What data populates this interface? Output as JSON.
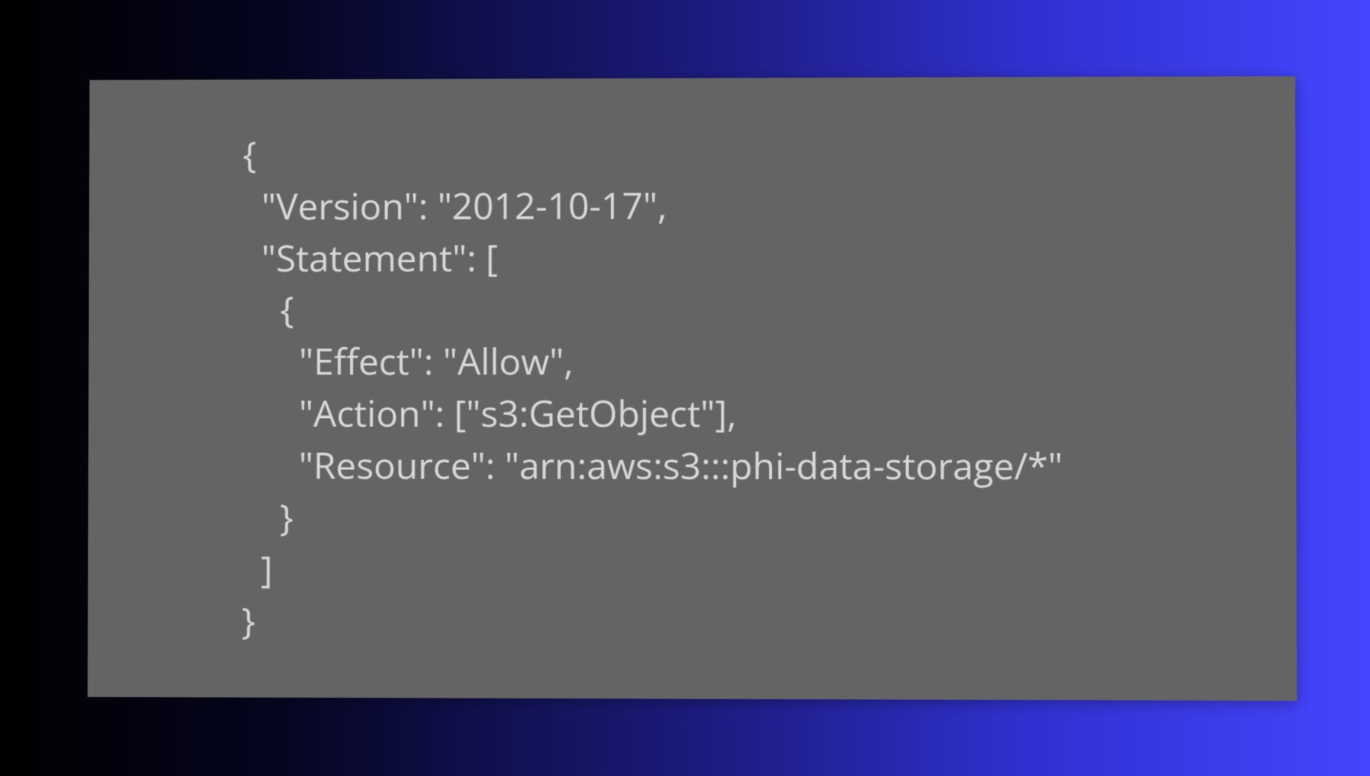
{
  "code_block": {
    "lines": [
      "{",
      "  \"Version\": \"2012-10-17\",",
      "  \"Statement\": [",
      "    {",
      "      \"Effect\": \"Allow\",",
      "      \"Action\": [\"s3:GetObject\"],",
      "      \"Resource\": \"arn:aws:s3:::phi-data-storage/*\"",
      "    }",
      "  ]",
      "}"
    ]
  }
}
